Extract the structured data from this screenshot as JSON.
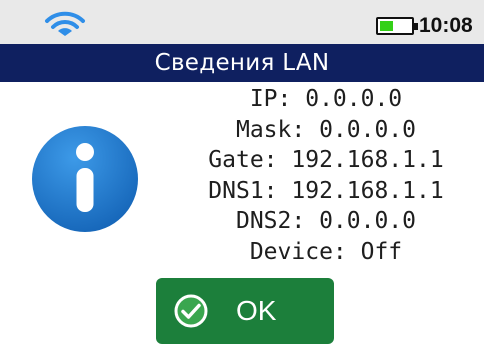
{
  "status_bar": {
    "wifi_icon": "wifi-icon",
    "battery_icon": "battery-icon",
    "time": "10:08"
  },
  "title": "Сведения  LAN",
  "network": {
    "ip": "IP: 0.0.0.0",
    "mask": "Mask: 0.0.0.0",
    "gate": "Gate: 192.168.1.1",
    "dns1": "DNS1: 192.168.1.1",
    "dns2": "DNS2: 0.0.0.0",
    "device": "Device: Off"
  },
  "info_icon": "info-icon",
  "ok_button": {
    "label": "OK",
    "icon": "check-circle-icon"
  },
  "colors": {
    "title_bar": "#0f2060",
    "ok_button": "#1c7f3b",
    "info_icon": "#1a73c9",
    "battery_fill": "#34d017"
  }
}
